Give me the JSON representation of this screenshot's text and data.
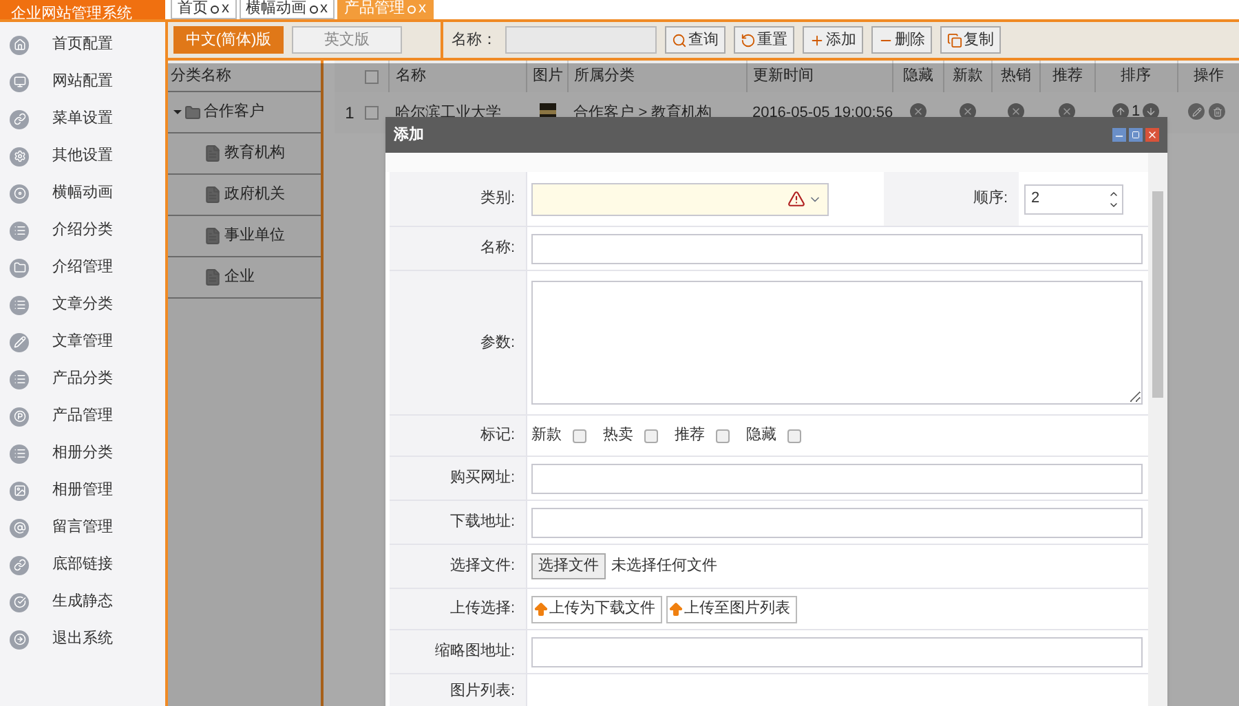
{
  "app_title": "企业网站管理系统",
  "tabs": [
    {
      "label": "首页",
      "close": "x",
      "selected": false
    },
    {
      "label": "横幅动画",
      "close": "x",
      "selected": false
    },
    {
      "label": "产品管理",
      "close": "x",
      "selected": true
    }
  ],
  "sidebar": {
    "items": [
      {
        "label": "首页配置"
      },
      {
        "label": "网站配置"
      },
      {
        "label": "菜单设置"
      },
      {
        "label": "其他设置"
      },
      {
        "label": "横幅动画"
      },
      {
        "label": "介绍分类"
      },
      {
        "label": "介绍管理"
      },
      {
        "label": "文章分类"
      },
      {
        "label": "文章管理"
      },
      {
        "label": "产品分类"
      },
      {
        "label": "产品管理"
      },
      {
        "label": "相册分类"
      },
      {
        "label": "相册管理"
      },
      {
        "label": "留言管理"
      },
      {
        "label": "底部链接"
      },
      {
        "label": "生成静态"
      },
      {
        "label": "退出系统"
      }
    ]
  },
  "language_tabs": [
    {
      "label": "中文(简体)版",
      "selected": true
    },
    {
      "label": "英文版",
      "selected": false
    }
  ],
  "search": {
    "label": "名称：",
    "buttons": [
      "查询",
      "重置",
      "添加",
      "删除",
      "复制"
    ]
  },
  "tree": {
    "header": "分类名称",
    "items": [
      {
        "label": "合作客户",
        "expanded": true,
        "children": [
          {
            "label": "教育机构"
          },
          {
            "label": "政府机关"
          },
          {
            "label": "事业单位"
          },
          {
            "label": "企业"
          }
        ]
      }
    ]
  },
  "table": {
    "select_all_checked": false,
    "columns": [
      "名称",
      "图片",
      "所属分类",
      "更新时间",
      "隐藏",
      "新款",
      "热销",
      "推荐",
      "排序",
      "操作"
    ],
    "rows": [
      {
        "index": "1",
        "checked": false,
        "name": "哈尔滨工业大学",
        "category": "合作客户 > 教育机构",
        "updated": "2016-05-05 19:00:56",
        "order": "1"
      }
    ]
  },
  "dialog": {
    "title": "添加",
    "rows": [
      {
        "kind": "select",
        "label": "类别:",
        "order_label": "顺序:",
        "order_value": "2"
      },
      {
        "kind": "text",
        "label": "名称:"
      },
      {
        "kind": "textarea",
        "label": "参数:"
      },
      {
        "kind": "checks",
        "label": "标记:",
        "options": [
          {
            "label": "新款",
            "checked": false
          },
          {
            "label": "热卖",
            "checked": false
          },
          {
            "label": "推荐",
            "checked": false
          },
          {
            "label": "隐藏",
            "checked": false
          }
        ]
      },
      {
        "kind": "text",
        "label": "购买网址:"
      },
      {
        "kind": "text",
        "label": "下载地址:"
      },
      {
        "kind": "file",
        "label": "选择文件:",
        "button": "选择文件",
        "status": "未选择任何文件"
      },
      {
        "kind": "upload",
        "label": "上传选择:",
        "buttons": [
          "上传为下载文件",
          "上传至图片列表"
        ]
      },
      {
        "kind": "text",
        "label": "缩略图地址:"
      },
      {
        "kind": "empty",
        "label": "图片列表:"
      }
    ]
  }
}
